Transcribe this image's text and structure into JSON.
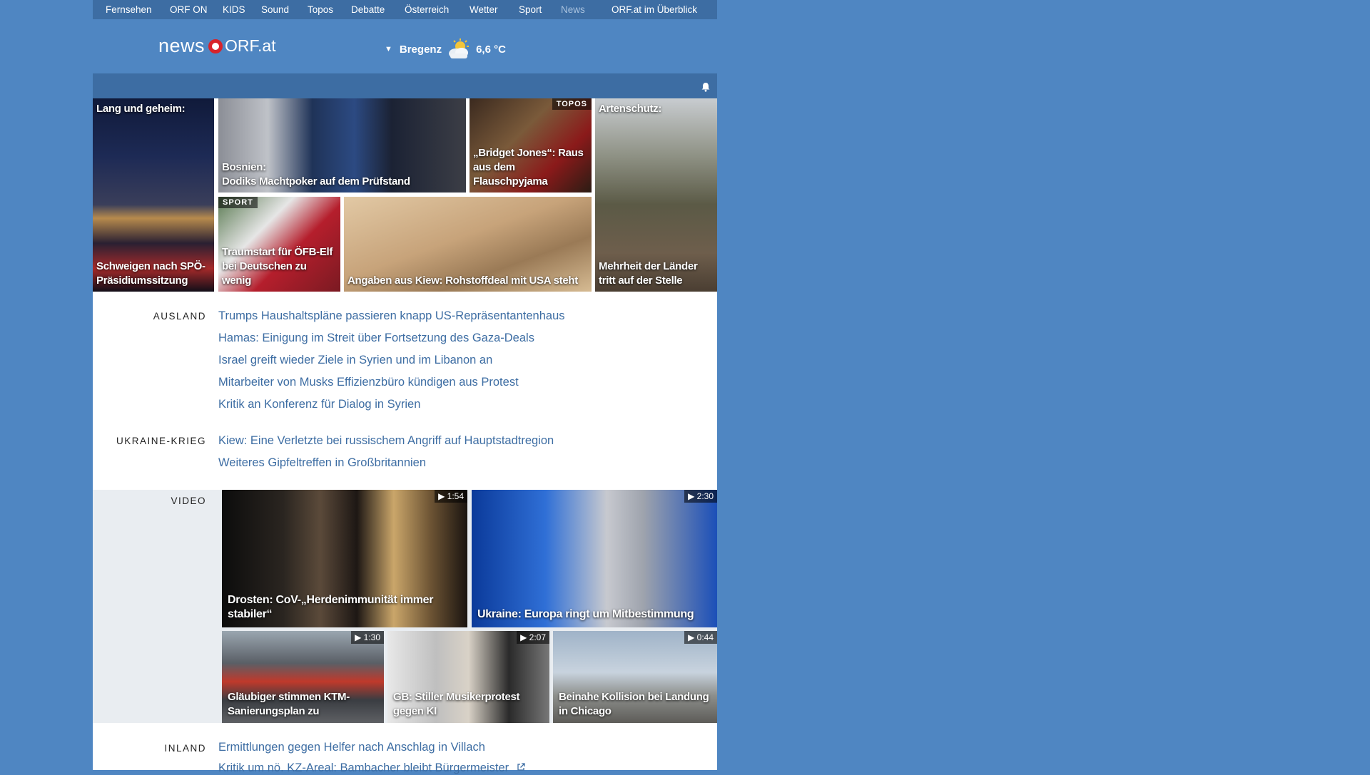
{
  "nav": {
    "items": [
      "Fernsehen",
      "ORF ON",
      "KIDS",
      "Sound",
      "Topos",
      "Debatte",
      "Österreich",
      "Wetter",
      "Sport",
      "News",
      "ORF.at im Überblick"
    ]
  },
  "header": {
    "logo_news": "news",
    "logo_orf": "ORF.at",
    "weather": {
      "city": "Bregenz",
      "temp": "6,6 °C",
      "icon": "partly-cloudy-icon"
    }
  },
  "teasers": [
    {
      "top": "Lang und geheim:",
      "title": "Schweigen nach SPÖ-Präsidiumssitzung"
    },
    {
      "title": "Bosnien:\nDodiks Machtpoker auf dem Prüfstand"
    },
    {
      "tag": "TOPOS",
      "title": "„Bridget Jones“: Raus aus dem Flauschpyjama"
    },
    {
      "top": "Artenschutz:",
      "title": "Mehrheit der Länder tritt auf der Stelle"
    },
    {
      "tag": "SPORT",
      "title": "Traumstart für ÖFB-Elf bei Deutschen zu wenig"
    },
    {
      "title": "Angaben aus Kiew: Rohstoffdeal mit USA steht"
    }
  ],
  "sections": {
    "ausland": {
      "label": "AUSLAND",
      "headlines": [
        "Trumps Haushaltspläne passieren knapp US-Repräsentantenhaus",
        "Hamas: Einigung im Streit über Fortsetzung des Gaza-Deals",
        "Israel greift wieder Ziele in Syrien und im Libanon an",
        "Mitarbeiter von Musks Effizienzbüro kündigen aus Protest",
        "Kritik an Konferenz für Dialog in Syrien"
      ]
    },
    "ukraine": {
      "label": "UKRAINE-KRIEG",
      "headlines": [
        "Kiew: Eine Verletzte bei russischem Angriff auf Hauptstadtregion",
        "Weiteres Gipfeltreffen in Großbritannien"
      ]
    },
    "video": {
      "label": "VIDEO",
      "items": [
        {
          "title": "Drosten: CoV-„Herdenimmunität immer stabiler“",
          "duration": "▶ 1:54"
        },
        {
          "title": "Ukraine: Europa ringt um Mitbestimmung",
          "duration": "▶ 2:30"
        },
        {
          "title": "Gläubiger stimmen KTM-Sanierungsplan zu",
          "duration": "▶ 1:30"
        },
        {
          "title": "GB: Stiller Musikerprotest gegen KI",
          "duration": "▶ 2:07"
        },
        {
          "title": "Beinahe Kollision bei Landung in Chicago",
          "duration": "▶ 0:44"
        }
      ]
    },
    "inland": {
      "label": "INLAND",
      "headlines": [
        "Ermittlungen gegen Helfer nach Anschlag in Villach",
        "Kritik um nö. KZ-Areal: Bambacher bleibt Bürgermeister"
      ],
      "external_icon": "external-link-icon"
    }
  },
  "colors": {
    "background": "#4f86c2",
    "nav": "#3d6da3",
    "link": "#3d6da3",
    "logo_ring": "#d8232a"
  }
}
